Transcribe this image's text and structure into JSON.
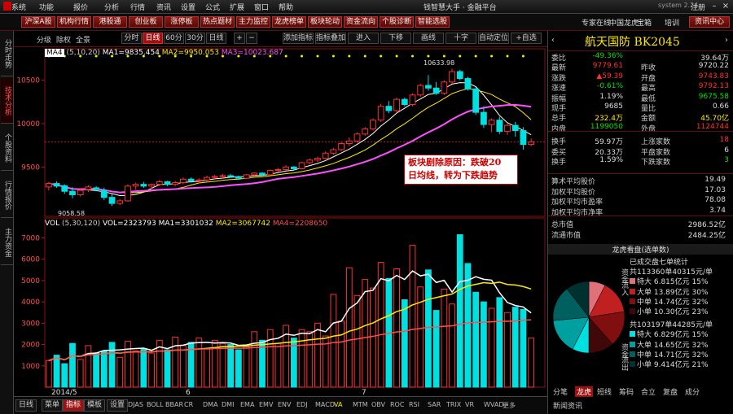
{
  "titlebar": {
    "menu": [
      "系统",
      "功能",
      "报价",
      "分析",
      "行情",
      "资讯",
      "设置",
      "公式",
      "扩展",
      "窗口",
      "帮助"
    ],
    "title": "钱智慧大手 · 金融平台",
    "version": "system 2.24",
    "login": "注册"
  },
  "toolbar": {
    "buttons": [
      "沪深A股",
      "机构行情",
      "港股通",
      "创业板",
      "涨停板",
      "热点题材",
      "主力监控",
      "龙虎榜单",
      "板块轮动",
      "资金流向",
      "个股诊断",
      "智能选股"
    ],
    "right": [
      "专家在线",
      "中国龙虎",
      "宝箱",
      "培训"
    ],
    "rightbtn": "资讯中心"
  },
  "leftstrip": [
    "分时走势",
    "技术分析",
    "个股资料",
    "行情报价",
    "主力资金"
  ],
  "charttb": {
    "left": [
      "分级",
      "除权",
      "全景"
    ],
    "periods": [
      "分时",
      "日线",
      "60分",
      "30分",
      "日线"
    ],
    "tools": [
      "添加指标",
      "指标叠加",
      "进入",
      "下移",
      "画线",
      "十字",
      "自动定位",
      "+自选"
    ]
  },
  "legend_ma": {
    "name": "MA4",
    "params": "(5,10,20)",
    "ma1": "MA1=9835.454",
    "ma2": "MA2=9950.053",
    "ma3": "MA3=10023.687"
  },
  "legend_vol": {
    "name": "VOL",
    "params": "(5,30,120)",
    "vol": "VOL=2323793",
    "ma1": "MA1=3301032",
    "ma2": "MA2=3067742",
    "ma4": "MA4=2208650"
  },
  "annotation": {
    "lines": [
      "板块剧除原因：跌破20",
      "日均线，转为下跌趋势"
    ]
  },
  "price_marks": {
    "high": "10633.98",
    "low": "9058.58"
  },
  "chart_data": [
    {
      "type": "candlestick",
      "price_axis": [
        9500,
        10000,
        10500
      ],
      "price_ylim": [
        8950,
        10750
      ],
      "candles": [
        [
          9270,
          9330,
          9230,
          9310
        ],
        [
          9310,
          9335,
          9260,
          9280
        ],
        [
          9285,
          9300,
          9190,
          9220
        ],
        [
          9220,
          9270,
          9140,
          9180
        ],
        [
          9180,
          9260,
          9160,
          9230
        ],
        [
          9240,
          9290,
          9210,
          9270
        ],
        [
          9260,
          9280,
          9220,
          9240
        ],
        [
          9230,
          9260,
          9120,
          9150
        ],
        [
          9150,
          9190,
          9050,
          9080
        ],
        [
          9080,
          9130,
          9060,
          9110
        ],
        [
          9110,
          9300,
          9100,
          9280
        ],
        [
          9280,
          9320,
          9240,
          9300
        ],
        [
          9300,
          9330,
          9260,
          9280
        ],
        [
          9280,
          9310,
          9250,
          9300
        ],
        [
          9300,
          9350,
          9280,
          9330
        ],
        [
          9330,
          9340,
          9280,
          9300
        ],
        [
          9300,
          9340,
          9280,
          9320
        ],
        [
          9320,
          9380,
          9300,
          9360
        ],
        [
          9360,
          9380,
          9320,
          9340
        ],
        [
          9340,
          9370,
          9310,
          9350
        ],
        [
          9350,
          9400,
          9330,
          9380
        ],
        [
          9380,
          9410,
          9360,
          9390
        ],
        [
          9390,
          9420,
          9370,
          9400
        ],
        [
          9400,
          9420,
          9380,
          9390
        ],
        [
          9390,
          9400,
          9360,
          9370
        ],
        [
          9370,
          9420,
          9360,
          9410
        ],
        [
          9410,
          9440,
          9400,
          9430
        ],
        [
          9430,
          9440,
          9400,
          9410
        ],
        [
          9410,
          9470,
          9400,
          9460
        ],
        [
          9460,
          9490,
          9440,
          9470
        ],
        [
          9470,
          9520,
          9460,
          9500
        ],
        [
          9500,
          9510,
          9470,
          9480
        ],
        [
          9480,
          9560,
          9470,
          9550
        ],
        [
          9550,
          9600,
          9530,
          9580
        ],
        [
          9580,
          9620,
          9560,
          9600
        ],
        [
          9600,
          9680,
          9590,
          9660
        ],
        [
          9660,
          9720,
          9640,
          9700
        ],
        [
          9700,
          9790,
          9680,
          9770
        ],
        [
          9770,
          9840,
          9740,
          9800
        ],
        [
          9800,
          9900,
          9780,
          9880
        ],
        [
          9880,
          9960,
          9860,
          9940
        ],
        [
          9940,
          10060,
          9920,
          10040
        ],
        [
          10040,
          10230,
          10020,
          10200
        ],
        [
          10200,
          10260,
          10120,
          10150
        ],
        [
          10150,
          10300,
          10130,
          10280
        ],
        [
          10280,
          10300,
          10200,
          10220
        ],
        [
          10220,
          10350,
          10200,
          10330
        ],
        [
          10330,
          10460,
          10310,
          10440
        ],
        [
          10440,
          10560,
          10380,
          10410
        ],
        [
          10410,
          10480,
          10330,
          10350
        ],
        [
          10350,
          10500,
          10330,
          10480
        ],
        [
          10480,
          10634,
          10460,
          10600
        ],
        [
          10600,
          10620,
          10500,
          10520
        ],
        [
          10520,
          10540,
          10380,
          10400
        ],
        [
          10400,
          10420,
          10100,
          10130
        ],
        [
          10130,
          10200,
          9950,
          9990
        ],
        [
          9990,
          10060,
          9900,
          10040
        ],
        [
          10040,
          10080,
          9880,
          9910
        ],
        [
          9910,
          10000,
          9870,
          9980
        ],
        [
          9980,
          10020,
          9850,
          9920
        ],
        [
          9920,
          9960,
          9700,
          9760
        ],
        [
          9760,
          9830,
          9740,
          9790
        ]
      ]
    },
    {
      "type": "bar",
      "volume_axis": [
        1000,
        2000,
        3000,
        4000,
        5000,
        6000,
        7000
      ],
      "volume_ylim": [
        0,
        7400
      ],
      "volume": [
        1250,
        1500,
        1100,
        2050,
        1300,
        1950,
        1600,
        1700,
        2100,
        1400,
        2150,
        1700,
        1800,
        1600,
        2200,
        1750,
        2350,
        1950,
        2100,
        2300,
        1800,
        2200,
        2050,
        2000,
        1750,
        1900,
        2600,
        2200,
        2700,
        2050,
        2900,
        2300,
        2700,
        2600,
        3000,
        2400,
        4350,
        3100,
        5600,
        4300,
        5050,
        4650,
        5850,
        5100,
        5550,
        4100,
        6650,
        4700,
        5500,
        3600,
        4600,
        3900,
        7150,
        5800,
        4450,
        4000,
        3700,
        4200,
        3500,
        3750,
        3650,
        2300
      ]
    },
    {
      "type": "pie",
      "title": "龙虎看盘(选单数)",
      "labels": [
        "特大",
        "大单",
        "中单",
        "小单",
        "特大",
        "大单",
        "中单",
        "小单"
      ],
      "values": [
        15,
        30,
        32,
        23,
        15,
        32,
        32,
        21
      ]
    }
  ],
  "volume_marks": {
    "x_labels": [
      "2014/5",
      "6",
      "7"
    ]
  },
  "bottombar": {
    "left": [
      "日线",
      "菜单",
      "指标",
      "模板",
      "设置"
    ],
    "indicators": [
      "DJAS",
      "BOLL",
      "BBAR",
      "CR",
      "DMA",
      "DMI",
      "EMA",
      "EMV",
      "ENV",
      "EDJ",
      "MACD",
      "VA",
      "MTM",
      "OBV",
      "ROC",
      "RSI",
      "SAR",
      "TRIX",
      "VR",
      "WVAD",
      "更多"
    ]
  },
  "quote": {
    "name": "航天国防",
    "code": "BK2045",
    "rows": [
      {
        "l": "委比",
        "v1": "-49.36%",
        "c1": "grn",
        "l2": "",
        "v2": "39.64万",
        "c2": "wht"
      },
      {
        "l": "最新",
        "v1": "9779.61",
        "c1": "red",
        "l2": "昨收",
        "v2": "9720.22",
        "c2": "wht"
      },
      {
        "l": "涨跌",
        "v1": "▲59.39",
        "c1": "red",
        "l2": "开盘",
        "v2": "9743.83",
        "c2": "red"
      },
      {
        "l": "涨速",
        "v1": "-0.61%",
        "c1": "grn",
        "l2": "最高",
        "v2": "9792.13",
        "c2": "red"
      },
      {
        "l": "振幅",
        "v1": "1.19%",
        "c1": "wht",
        "l2": "最低",
        "v2": "9675.58",
        "c2": "grn"
      },
      {
        "l": "现手",
        "v1": "9685",
        "c1": "wht",
        "l2": "量比",
        "v2": "0.66",
        "c2": "wht"
      },
      {
        "l": "总手",
        "v1": "232.4万",
        "c1": "yel",
        "l2": "金额",
        "v2": "45.70亿",
        "c2": "yel"
      },
      {
        "l": "内盘",
        "v1": "1199050",
        "c1": "grn",
        "l2": "外盘",
        "v2": "1124744",
        "c2": "red"
      },
      {
        "l": "换手",
        "v1": "59.97万",
        "c1": "wht",
        "l2": "上涨家数",
        "v2": "18",
        "c2": "red"
      },
      {
        "l": "委买",
        "v1": "20.33万",
        "c1": "wht",
        "l2": "平盘家数",
        "v2": "6",
        "c2": "wht"
      },
      {
        "l": "换手",
        "v1": "1.59%",
        "c1": "wht",
        "l2": "下跌家数",
        "v2": "3",
        "c2": "grn"
      }
    ],
    "stats": [
      {
        "l": "算术平均股价",
        "v": "19.49"
      },
      {
        "l": "加权平均股价",
        "v": "17.03"
      },
      {
        "l": "加权平均市盈率",
        "v": "78.08"
      },
      {
        "l": "加权平均市净率",
        "v": "3.74"
      },
      {
        "l": "总市值",
        "v": "2986.52亿"
      },
      {
        "l": "流通市值",
        "v": "2484.25亿"
      }
    ]
  },
  "dragon": {
    "title": "龙虎看盘(选单数)",
    "left_v": [
      "资金",
      "流入",
      "资金",
      "流出"
    ],
    "rows": [
      {
        "t": "已成交盘七单统计",
        "c": "#ddd",
        "sw": ""
      },
      {
        "t": "共113360单40315元/单",
        "c": "#ddd",
        "sw": ""
      },
      {
        "t": "特大  6.815亿元   15%",
        "c": "#ddd",
        "sw": "#e0707a"
      },
      {
        "t": "大单  13.89亿元   30%",
        "c": "#ddd",
        "sw": "#c02020"
      },
      {
        "t": "中单  14.74亿元   32%",
        "c": "#ddd",
        "sw": "#801010"
      },
      {
        "t": "小单  10.30亿元   23%",
        "c": "#ddd",
        "sw": "#400808"
      },
      {
        "t": "共103197单44285元/单",
        "c": "#ddd",
        "sw": ""
      },
      {
        "t": "特大  6.829亿元   15%",
        "c": "#ddd",
        "sw": "#00e0e0"
      },
      {
        "t": "大单  14.65亿元   32%",
        "c": "#ddd",
        "sw": "#00a0a0"
      },
      {
        "t": "中单  14.71亿元   32%",
        "c": "#ddd",
        "sw": "#006060"
      },
      {
        "t": "小单  9.414亿元   21%",
        "c": "#ddd",
        "sw": "#003030"
      }
    ],
    "tabs": [
      "分笔",
      "龙虎",
      "短线",
      "筹码",
      "合立",
      "复盘",
      "成分"
    ],
    "footer": "新闻资讯"
  },
  "colors": {
    "up": "#ff3030",
    "down": "#00e0e0",
    "ma1": "#ffffff",
    "ma2": "#ffea00",
    "ma3": "#ff50ff",
    "accent": "#a01010"
  }
}
